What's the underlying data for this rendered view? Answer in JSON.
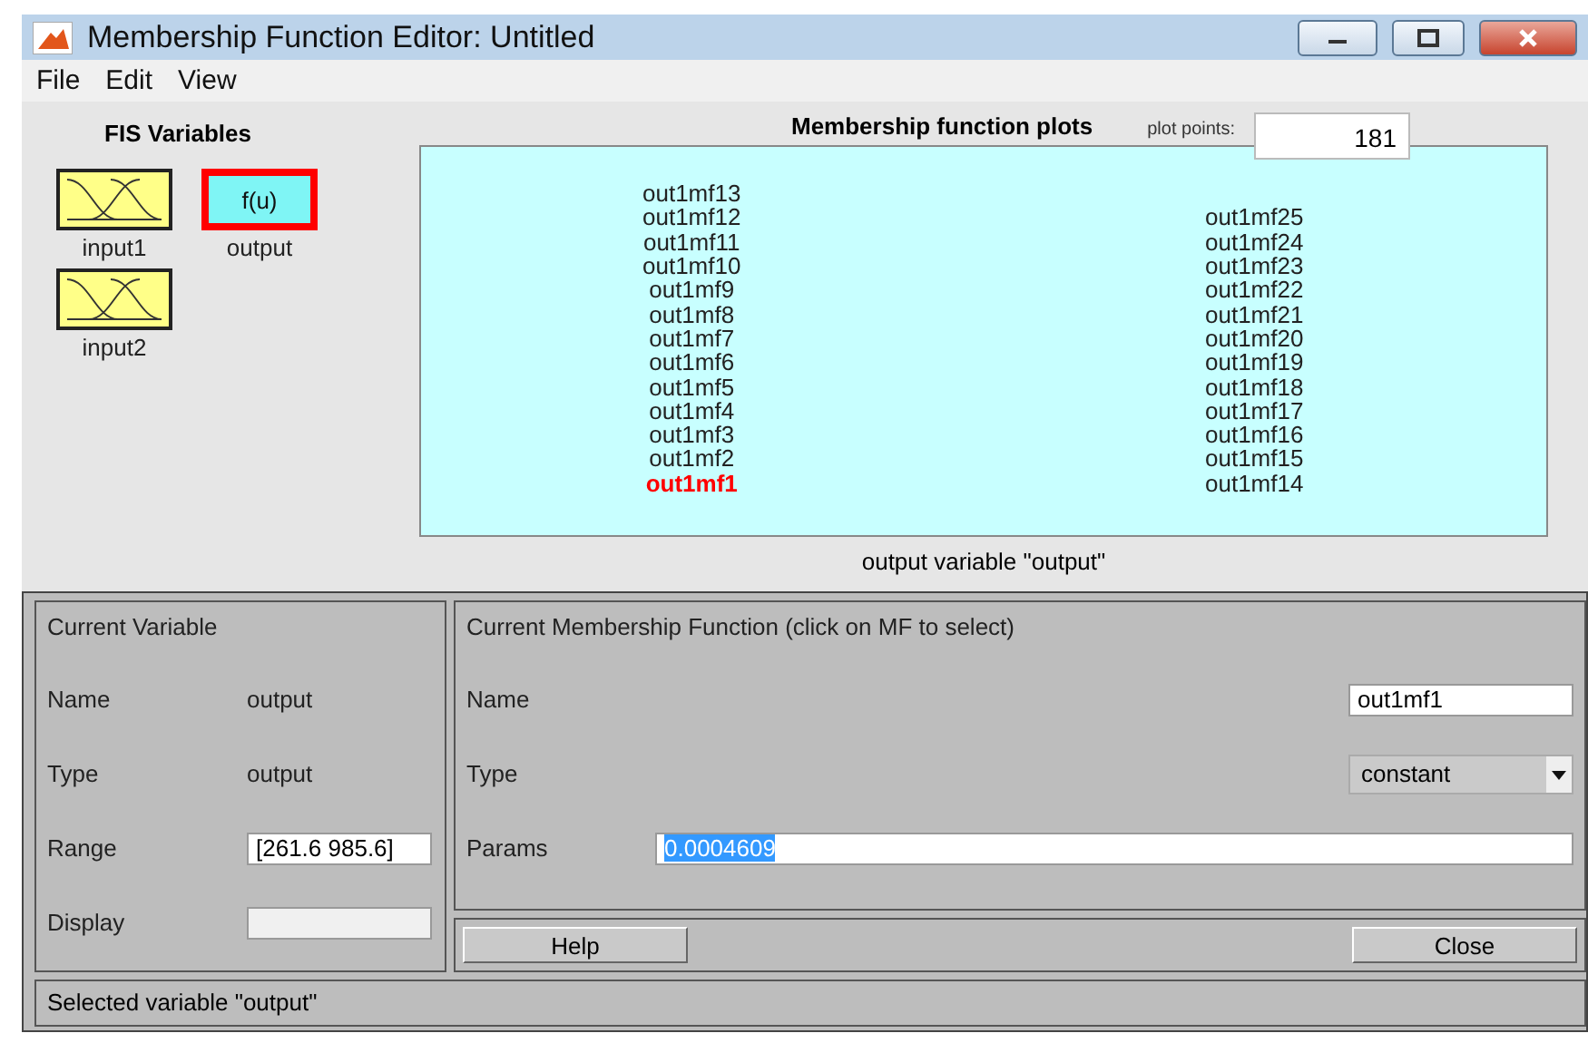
{
  "window": {
    "title": "Membership Function Editor: Untitled"
  },
  "menu": [
    "File",
    "Edit",
    "View"
  ],
  "fis_variables": {
    "title": "FIS Variables",
    "items": [
      {
        "kind": "input",
        "label": "input1",
        "selected": false
      },
      {
        "kind": "output",
        "label": "output",
        "symbol": "f(u)",
        "selected": true
      },
      {
        "kind": "input",
        "label": "input2",
        "selected": false
      }
    ]
  },
  "plots": {
    "title": "Membership function plots",
    "plot_points_label": "plot points:",
    "plot_points": "181",
    "caption": "output variable \"output\"",
    "columns": [
      [
        {
          "label": "out1mf13",
          "selected": false
        },
        {
          "label": "out1mf12",
          "selected": false
        },
        {
          "label": "out1mf11",
          "selected": false
        },
        {
          "label": "out1mf10",
          "selected": false
        },
        {
          "label": "out1mf9",
          "selected": false
        },
        {
          "label": "out1mf8",
          "selected": false
        },
        {
          "label": "out1mf7",
          "selected": false
        },
        {
          "label": "out1mf6",
          "selected": false
        },
        {
          "label": "out1mf5",
          "selected": false
        },
        {
          "label": "out1mf4",
          "selected": false
        },
        {
          "label": "out1mf3",
          "selected": false
        },
        {
          "label": "out1mf2",
          "selected": false
        },
        {
          "label": "out1mf1",
          "selected": true
        }
      ],
      [
        {
          "label": "out1mf25",
          "selected": false
        },
        {
          "label": "out1mf24",
          "selected": false
        },
        {
          "label": "out1mf23",
          "selected": false
        },
        {
          "label": "out1mf22",
          "selected": false
        },
        {
          "label": "out1mf21",
          "selected": false
        },
        {
          "label": "out1mf20",
          "selected": false
        },
        {
          "label": "out1mf19",
          "selected": false
        },
        {
          "label": "out1mf18",
          "selected": false
        },
        {
          "label": "out1mf17",
          "selected": false
        },
        {
          "label": "out1mf16",
          "selected": false
        },
        {
          "label": "out1mf15",
          "selected": false
        },
        {
          "label": "out1mf14",
          "selected": false
        }
      ]
    ]
  },
  "current_variable": {
    "title": "Current Variable",
    "name_label": "Name",
    "name": "output",
    "type_label": "Type",
    "type": "output",
    "range_label": "Range",
    "range": "[261.6 985.6]",
    "display_label": "Display"
  },
  "current_mf": {
    "title": "Current Membership Function (click on MF to select)",
    "name_label": "Name",
    "name": "out1mf1",
    "type_label": "Type",
    "type": "constant",
    "params_label": "Params",
    "params": "0.0004609"
  },
  "buttons": [
    "Help",
    "Close"
  ],
  "status_bar": "Selected variable \"output\""
}
